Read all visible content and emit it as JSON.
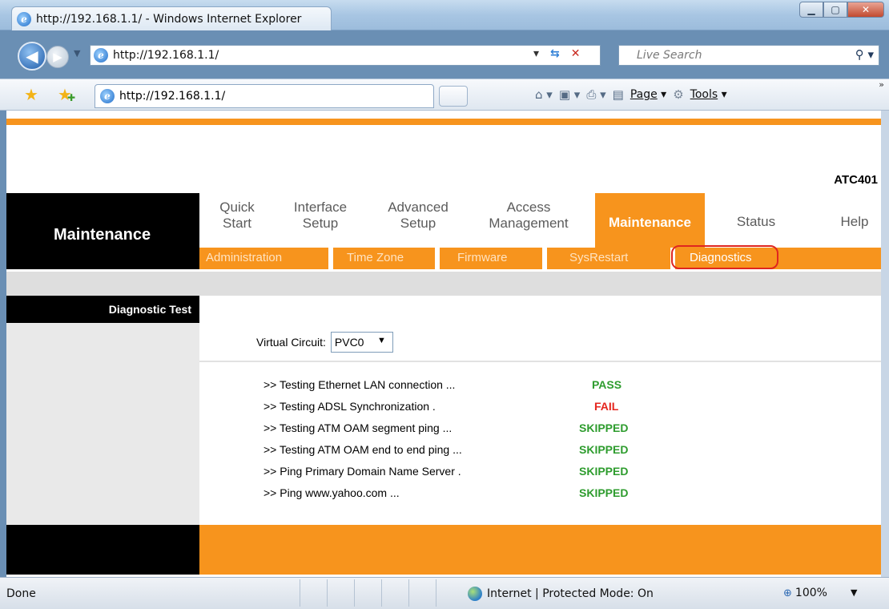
{
  "browser": {
    "window_title": "http://192.168.1.1/ - Windows Internet Explorer",
    "address_url": "http://192.168.1.1/",
    "search_placeholder": "Live Search",
    "tab_title": "http://192.168.1.1/",
    "commands": {
      "page": "Page",
      "tools": "Tools"
    },
    "status": {
      "done": "Done",
      "zone": "Internet | Protected Mode: On",
      "zoom": "100%"
    }
  },
  "page": {
    "product": "ATC401",
    "section_title": "Maintenance",
    "menu": [
      {
        "label": "Quick Start"
      },
      {
        "label": "Interface Setup"
      },
      {
        "label": "Advanced Setup"
      },
      {
        "label": "Access Management"
      },
      {
        "label": "Maintenance",
        "active": true
      },
      {
        "label": "Status"
      },
      {
        "label": "Help"
      }
    ],
    "submenu": [
      "Administration",
      "Time Zone",
      "Firmware",
      "SysRestart",
      "Diagnostics"
    ],
    "side_label": "Diagnostic Test",
    "virtual_circuit": {
      "label": "Virtual Circuit:",
      "value": "PVC0"
    },
    "tests": [
      {
        "name": ">> Testing Ethernet LAN connection ...",
        "result": "PASS"
      },
      {
        "name": ">> Testing ADSL Synchronization .",
        "result": "FAIL"
      },
      {
        "name": ">> Testing ATM OAM segment ping ...",
        "result": "SKIPPED"
      },
      {
        "name": ">> Testing ATM OAM end to end ping ...",
        "result": "SKIPPED"
      },
      {
        "name": ">> Ping Primary Domain Name Server .",
        "result": "SKIPPED"
      },
      {
        "name": ">> Ping www.yahoo.com ...",
        "result": "SKIPPED"
      }
    ]
  },
  "colors": {
    "accent": "#f7941d",
    "pass": "#2e9c2e",
    "fail": "#e5261f",
    "highlight": "#e0261f"
  }
}
